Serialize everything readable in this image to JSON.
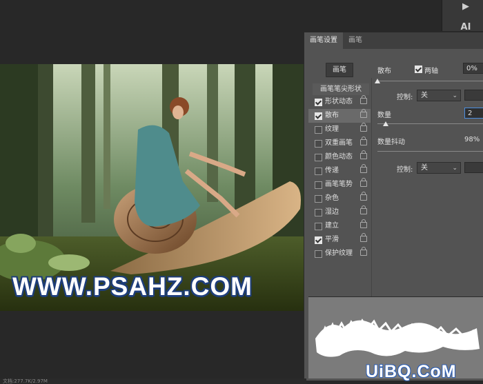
{
  "toolbar": {
    "play_icon": "▶",
    "ai_label": "AI",
    "para_icon": "¶"
  },
  "photo": {
    "watermark": "WWW.PSAHZ.COM"
  },
  "panel": {
    "tabs": [
      "画笔设置",
      "画笔"
    ],
    "brush_button": "画笔",
    "list_header": "画笔笔尖形状",
    "items": [
      {
        "label": "形状动态",
        "checked": true
      },
      {
        "label": "散布",
        "checked": true
      },
      {
        "label": "纹理",
        "checked": false
      },
      {
        "label": "双重画笔",
        "checked": false
      },
      {
        "label": "颜色动态",
        "checked": false
      },
      {
        "label": "传递",
        "checked": false
      },
      {
        "label": "画笔笔势",
        "checked": false
      },
      {
        "label": "杂色",
        "checked": false
      },
      {
        "label": "湿边",
        "checked": false
      },
      {
        "label": "建立",
        "checked": false
      },
      {
        "label": "平滑",
        "checked": true
      },
      {
        "label": "保护纹理",
        "checked": false
      }
    ],
    "scatter": {
      "label": "散布",
      "both_axes_label": "两轴",
      "value": "0%",
      "control_label": "控制:",
      "control_value": "关"
    },
    "count": {
      "label": "数量",
      "value": "2"
    },
    "count_jitter": {
      "label": "数量抖动",
      "value": "98%",
      "control_label": "控制:",
      "control_value": "关"
    }
  },
  "logo": {
    "text": "UiBQ.CoM"
  },
  "status": {
    "text": "文档:277.7K/2.97M"
  },
  "colors": {
    "panel_bg": "#535353",
    "canvas_bg": "#282828",
    "focus": "#4b8ee0"
  }
}
